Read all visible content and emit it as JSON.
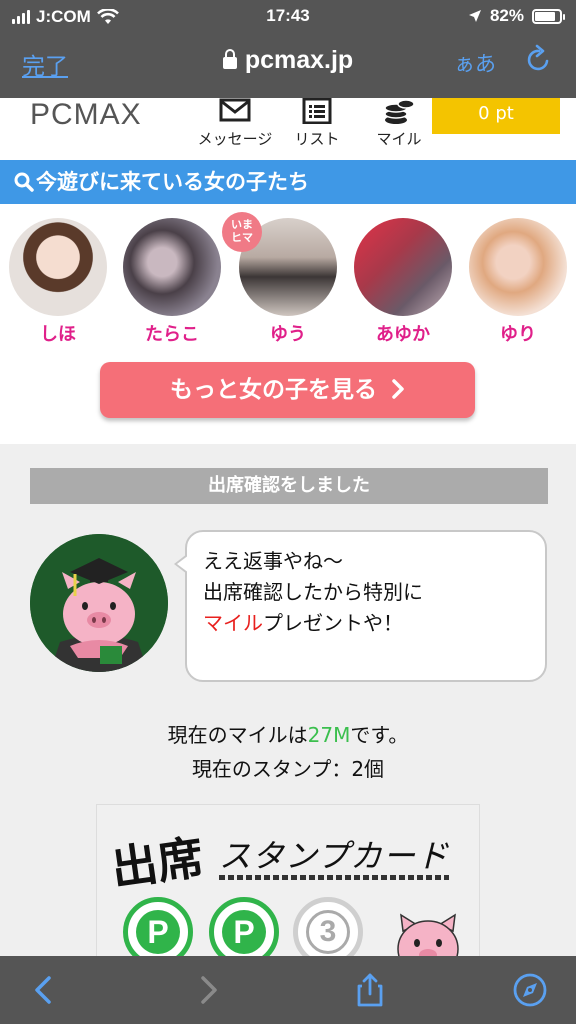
{
  "status": {
    "carrier": "J:COM",
    "time": "17:43",
    "battery": "82%",
    "battery_level": 0.82
  },
  "browser": {
    "done_label": "完了",
    "url": "pcmax.jp",
    "text_size_label": "ぁあ"
  },
  "header": {
    "logo": "PCMAX",
    "nav": [
      {
        "label": "メッセージ",
        "icon": "envelope-icon"
      },
      {
        "label": "リスト",
        "icon": "list-icon"
      },
      {
        "label": "マイル",
        "icon": "coins-icon"
      }
    ],
    "points": "0 pt"
  },
  "girls_section": {
    "title": "今遊びに来ている女の子たち",
    "girls": [
      {
        "name": "しほ",
        "color": "#e8cfc2"
      },
      {
        "name": "たらこ",
        "color": "#6c6470"
      },
      {
        "name": "ゆう",
        "color": "#b9aca6",
        "badge": "いまヒマ"
      },
      {
        "name": "あゆか",
        "color": "#c4485a"
      },
      {
        "name": "ゆり",
        "color": "#e9c4b0"
      }
    ],
    "more_label": "もっと女の子を見る"
  },
  "attendance": {
    "title": "出席確認をしました",
    "bubble_line1": "ええ返事やね〜",
    "bubble_line2": "出席確認したから特別に",
    "bubble_highlight": "マイル",
    "bubble_line3_rest": "プレゼントや！",
    "mile_prefix": "現在のマイルは",
    "mile_value": "27M",
    "mile_suffix": "です。",
    "stamp_label": "現在のスタンプ：2個"
  },
  "stamp_card": {
    "title_big": "出席",
    "title": "スタンプカード",
    "stamps": [
      "P",
      "P",
      "3"
    ]
  },
  "colors": {
    "accent_blue": "#3f98e6",
    "pink_name": "#e0208a",
    "button_red": "#f56f78",
    "points_yellow": "#f4c400"
  }
}
